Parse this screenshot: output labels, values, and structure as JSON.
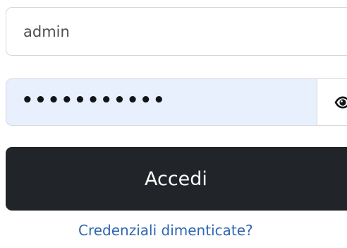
{
  "login_form": {
    "username": {
      "value": "admin"
    },
    "password": {
      "masked_value": "•••••••••••",
      "toggle_icon": "eye-icon"
    },
    "submit_label": "Accedi",
    "forgot_link": "Credenziali dimenticate?"
  },
  "colors": {
    "password_autofill_bg": "#e8f0fe",
    "button_bg": "#212529",
    "link": "#2f66b2",
    "border": "#d5d8dd"
  }
}
